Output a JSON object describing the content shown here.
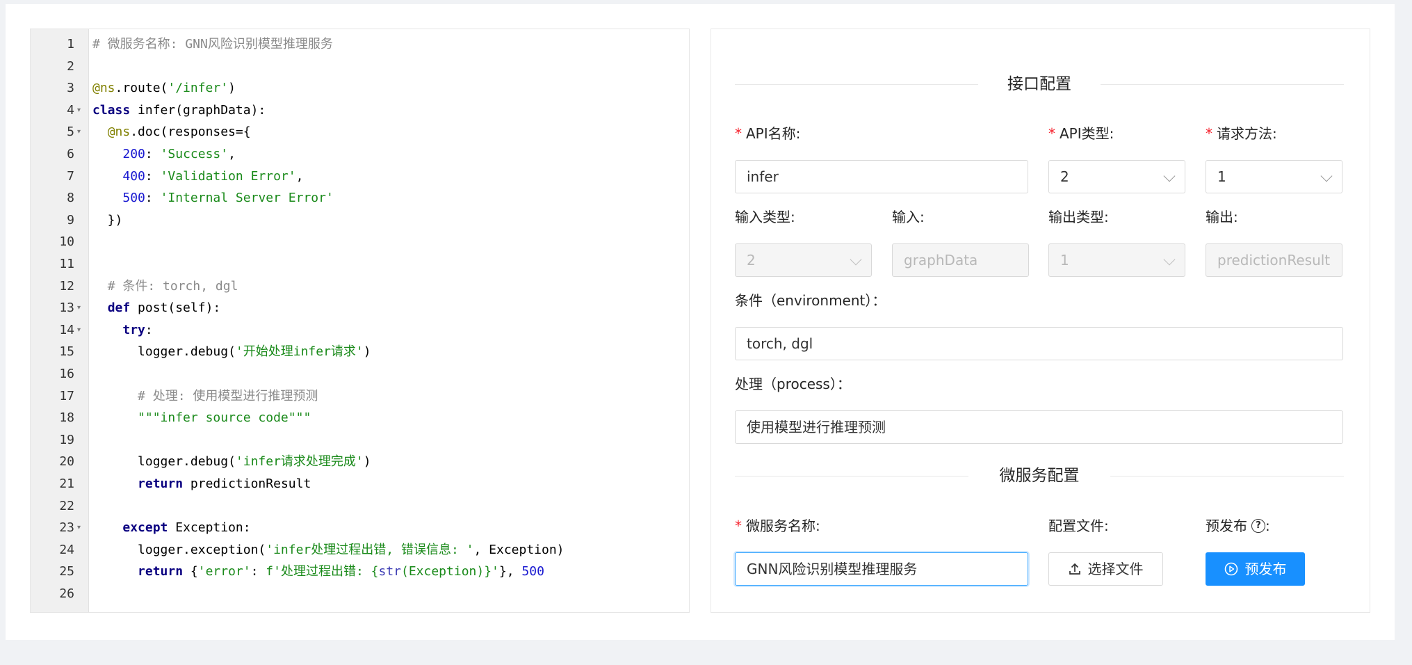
{
  "editor": {
    "lines": [
      {
        "n": "1",
        "tokens": [
          {
            "t": "# 微服务名称: GNN风险识别模型推理服务",
            "c": "comment"
          }
        ]
      },
      {
        "n": "2",
        "tokens": []
      },
      {
        "n": "3",
        "tokens": [
          {
            "t": "@ns",
            "c": "decorator"
          },
          {
            "t": ".route(",
            "c": "plain"
          },
          {
            "t": "'/infer'",
            "c": "string"
          },
          {
            "t": ")",
            "c": "plain"
          }
        ]
      },
      {
        "n": "4",
        "fold": true,
        "tokens": [
          {
            "t": "class",
            "c": "keyword"
          },
          {
            "t": " infer(graphData):",
            "c": "plain"
          }
        ]
      },
      {
        "n": "5",
        "fold": true,
        "tokens": [
          {
            "t": "  ",
            "c": "plain"
          },
          {
            "t": "@ns",
            "c": "decorator"
          },
          {
            "t": ".doc(responses={",
            "c": "plain"
          }
        ]
      },
      {
        "n": "6",
        "tokens": [
          {
            "t": "    ",
            "c": "plain"
          },
          {
            "t": "200",
            "c": "number"
          },
          {
            "t": ": ",
            "c": "plain"
          },
          {
            "t": "'Success'",
            "c": "string"
          },
          {
            "t": ",",
            "c": "plain"
          }
        ]
      },
      {
        "n": "7",
        "tokens": [
          {
            "t": "    ",
            "c": "plain"
          },
          {
            "t": "400",
            "c": "number"
          },
          {
            "t": ": ",
            "c": "plain"
          },
          {
            "t": "'Validation Error'",
            "c": "string"
          },
          {
            "t": ",",
            "c": "plain"
          }
        ]
      },
      {
        "n": "8",
        "tokens": [
          {
            "t": "    ",
            "c": "plain"
          },
          {
            "t": "500",
            "c": "number"
          },
          {
            "t": ": ",
            "c": "plain"
          },
          {
            "t": "'Internal Server Error'",
            "c": "string"
          }
        ]
      },
      {
        "n": "9",
        "tokens": [
          {
            "t": "  })",
            "c": "plain"
          }
        ]
      },
      {
        "n": "10",
        "tokens": []
      },
      {
        "n": "11",
        "tokens": []
      },
      {
        "n": "12",
        "tokens": [
          {
            "t": "  ",
            "c": "plain"
          },
          {
            "t": "# 条件: torch, dgl",
            "c": "comment"
          }
        ]
      },
      {
        "n": "13",
        "fold": true,
        "tokens": [
          {
            "t": "  ",
            "c": "plain"
          },
          {
            "t": "def",
            "c": "keyword"
          },
          {
            "t": " post(self):",
            "c": "plain"
          }
        ]
      },
      {
        "n": "14",
        "fold": true,
        "tokens": [
          {
            "t": "    ",
            "c": "plain"
          },
          {
            "t": "try",
            "c": "keyword"
          },
          {
            "t": ":",
            "c": "plain"
          }
        ]
      },
      {
        "n": "15",
        "tokens": [
          {
            "t": "      logger.debug(",
            "c": "plain"
          },
          {
            "t": "'开始处理infer请求'",
            "c": "string"
          },
          {
            "t": ")",
            "c": "plain"
          }
        ]
      },
      {
        "n": "16",
        "tokens": []
      },
      {
        "n": "17",
        "tokens": [
          {
            "t": "      ",
            "c": "plain"
          },
          {
            "t": "# 处理: 使用模型进行推理预测",
            "c": "comment"
          }
        ]
      },
      {
        "n": "18",
        "tokens": [
          {
            "t": "      ",
            "c": "plain"
          },
          {
            "t": "\"\"\"infer source code\"\"\"",
            "c": "string"
          }
        ]
      },
      {
        "n": "19",
        "tokens": []
      },
      {
        "n": "20",
        "tokens": [
          {
            "t": "      logger.debug(",
            "c": "plain"
          },
          {
            "t": "'infer请求处理完成'",
            "c": "string"
          },
          {
            "t": ")",
            "c": "plain"
          }
        ]
      },
      {
        "n": "21",
        "tokens": [
          {
            "t": "      ",
            "c": "plain"
          },
          {
            "t": "return",
            "c": "keyword"
          },
          {
            "t": " predictionResult",
            "c": "plain"
          }
        ]
      },
      {
        "n": "22",
        "tokens": []
      },
      {
        "n": "23",
        "fold": true,
        "tokens": [
          {
            "t": "    ",
            "c": "plain"
          },
          {
            "t": "except",
            "c": "keyword"
          },
          {
            "t": " Exception:",
            "c": "plain"
          }
        ]
      },
      {
        "n": "24",
        "tokens": [
          {
            "t": "      logger.exception(",
            "c": "plain"
          },
          {
            "t": "'infer处理过程出错, 错误信息: '",
            "c": "string"
          },
          {
            "t": ", Exception)",
            "c": "plain"
          }
        ]
      },
      {
        "n": "25",
        "tokens": [
          {
            "t": "      ",
            "c": "plain"
          },
          {
            "t": "return",
            "c": "keyword"
          },
          {
            "t": " {",
            "c": "plain"
          },
          {
            "t": "'error'",
            "c": "string"
          },
          {
            "t": ": ",
            "c": "plain"
          },
          {
            "t": "f'处理过程出错: {",
            "c": "string"
          },
          {
            "t": "str",
            "c": "builtin"
          },
          {
            "t": "(Exception)}'",
            "c": "string"
          },
          {
            "t": "}, ",
            "c": "plain"
          },
          {
            "t": "500",
            "c": "number"
          }
        ]
      },
      {
        "n": "26",
        "tokens": []
      }
    ]
  },
  "interface_config": {
    "title": "接口配置",
    "required_mark": "*",
    "api_name_label": "API名称:",
    "api_name_value": "infer",
    "api_type_label": "API类型:",
    "api_type_value": "2",
    "method_label": "请求方法:",
    "method_value": "1",
    "input_type_label": "输入类型:",
    "input_type_value": "2",
    "input_label": "输入:",
    "input_value": "graphData",
    "output_type_label": "输出类型:",
    "output_type_value": "1",
    "output_label": "输出:",
    "output_value": "predictionResult",
    "env_label": "条件（environment）：",
    "env_value": "torch, dgl",
    "process_label": "处理（process）：",
    "process_value": "使用模型进行推理预测"
  },
  "service_config": {
    "title": "微服务配置",
    "service_name_label": "微服务名称:",
    "service_name_value": "GNN风险识别模型推理服务",
    "config_file_label": "配置文件:",
    "choose_file_button": "选择文件",
    "prerelease_label": "预发布",
    "prerelease_label_colon": ":",
    "prerelease_button": "预发布"
  },
  "colors": {
    "primary": "#1890ff",
    "required": "#f5222d",
    "comment": "#8a8a8a",
    "keyword": "#0a0080",
    "string": "#1a8a1a",
    "number": "#1818d0",
    "decorator": "#808000"
  },
  "icons": {
    "upload": "upload-icon",
    "play": "play-circle-icon",
    "question": "question-circle-icon",
    "fold": "fold-arrow-icon",
    "select_caret": "chevron-down-icon"
  }
}
